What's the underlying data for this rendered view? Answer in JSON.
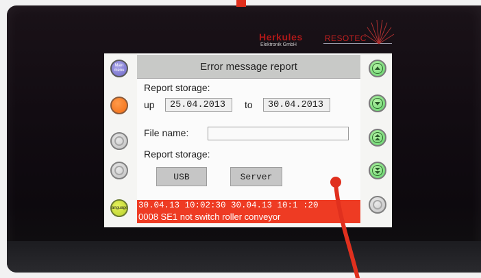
{
  "brand": {
    "name": "Herkules",
    "subtitle": "Elektronik GmbH",
    "name2": "RESOTEC"
  },
  "left_buttons": [
    {
      "label": "Main menu",
      "color": "#7d77d2"
    },
    {
      "label": "",
      "color": "#f27522"
    },
    {
      "label": "",
      "color": "#c8c8c8"
    },
    {
      "label": "",
      "color": "#c8c8c8"
    },
    {
      "label": "language",
      "color": "#c8dc3a"
    }
  ],
  "right_buttons": [
    {
      "icon": "up-arrow-icon",
      "color": "#6cd873"
    },
    {
      "icon": "down-arrow-icon",
      "color": "#6cd873"
    },
    {
      "icon": "double-up-arrow-icon",
      "color": "#6cd873"
    },
    {
      "icon": "double-down-arrow-icon",
      "color": "#6cd873"
    },
    {
      "icon": "",
      "color": "#c8c8c8"
    }
  ],
  "report": {
    "title": "Error message report",
    "storage_label": "Report storage:",
    "up_label": "up",
    "from_date": "25.04.2013",
    "to_label": "to",
    "to_date": "30.04.2013",
    "file_name_label": "File name:",
    "file_name_value": "",
    "storage_label_2": "Report storage:",
    "usb_label": "USB",
    "server_label": "Server"
  },
  "status": {
    "line1": "30.04.13  10:02:30      30.04.13  10:1  :20",
    "line2": "0008  SE1  not switch roller conveyor",
    "color": "#ee3b23"
  }
}
